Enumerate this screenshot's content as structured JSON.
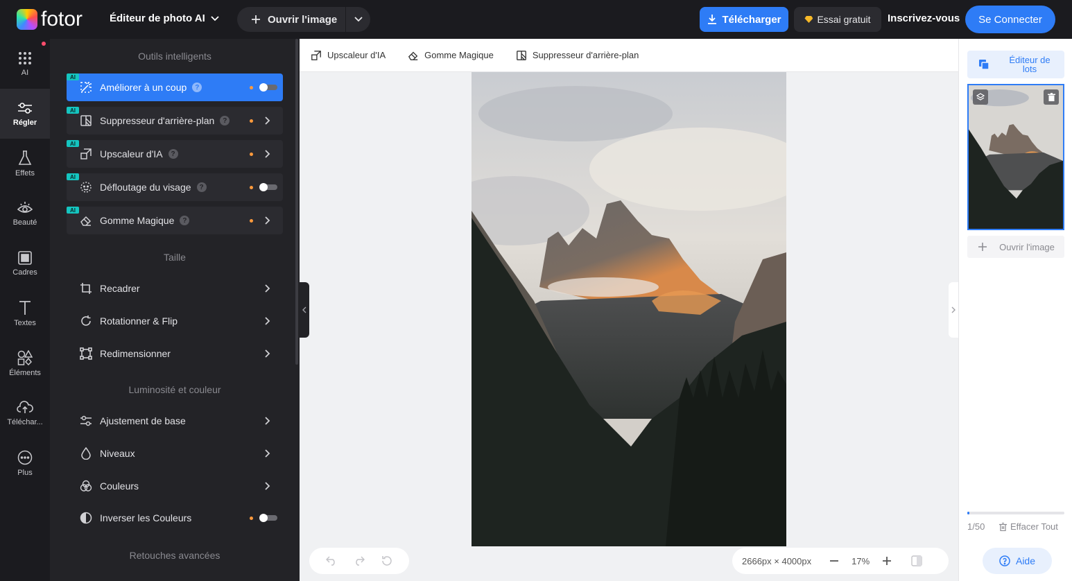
{
  "topbar": {
    "logo_text": "fotor",
    "app_title": "Éditeur de photo AI",
    "open_image": "Ouvrir l'image",
    "download": "Télécharger",
    "trial": "Essai gratuit",
    "signup": "Inscrivez-vous",
    "login": "Se Connecter"
  },
  "rail": [
    {
      "label": "AI",
      "icon": "grid-dots-icon"
    },
    {
      "label": "Régler",
      "icon": "sliders-icon"
    },
    {
      "label": "Effets",
      "icon": "flask-icon"
    },
    {
      "label": "Beauté",
      "icon": "eye-icon"
    },
    {
      "label": "Cadres",
      "icon": "frame-icon"
    },
    {
      "label": "Textes",
      "icon": "text-icon"
    },
    {
      "label": "Éléments",
      "icon": "shapes-icon"
    },
    {
      "label": "Téléchar...",
      "icon": "cloud-upload-icon"
    },
    {
      "label": "Plus",
      "icon": "more-icon"
    }
  ],
  "panel": {
    "section_smart": "Outils intelligents",
    "smart_tools": [
      {
        "label": "Améliorer à un coup",
        "control": "toggle",
        "active": true,
        "icon": "magic-enhance-icon"
      },
      {
        "label": "Suppresseur d'arrière-plan",
        "control": "chevron",
        "active": false,
        "icon": "background-remove-icon"
      },
      {
        "label": "Upscaleur d'IA",
        "control": "chevron",
        "active": false,
        "icon": "upscale-icon"
      },
      {
        "label": "Défloutage du visage",
        "control": "toggle",
        "active": false,
        "icon": "face-unblur-icon"
      },
      {
        "label": "Gomme Magique",
        "control": "chevron",
        "active": false,
        "icon": "eraser-icon"
      }
    ],
    "ai_badge": "AI",
    "help_glyph": "?",
    "section_size": "Taille",
    "size_tools": [
      {
        "label": "Recadrer",
        "icon": "crop-icon"
      },
      {
        "label": "Rotationner & Flip",
        "icon": "rotate-icon"
      },
      {
        "label": "Redimensionner",
        "icon": "resize-icon"
      }
    ],
    "section_light": "Luminosité et couleur",
    "light_tools": [
      {
        "label": "Ajustement de base",
        "icon": "sliders-small-icon"
      },
      {
        "label": "Niveaux",
        "icon": "drop-icon"
      },
      {
        "label": "Couleurs",
        "icon": "color-circles-icon"
      }
    ],
    "invert": {
      "label": "Inverser les Couleurs",
      "icon": "invert-icon"
    },
    "section_advanced": "Retouches avancées"
  },
  "toolbar": [
    {
      "label": "Upscaleur d'IA",
      "icon": "upscale-icon"
    },
    {
      "label": "Gomme Magique",
      "icon": "eraser-icon"
    },
    {
      "label": "Suppresseur d'arrière-plan",
      "icon": "background-remove-icon"
    }
  ],
  "canvas": {
    "dimensions": "2666px × 4000px",
    "zoom": "17%"
  },
  "rightpanel": {
    "batch_editor": "Éditeur de lots",
    "open_image": "Ouvrir l'image",
    "count": "1/50",
    "progress": 0.02,
    "clear_all": "Effacer Tout",
    "help": "Aide"
  },
  "colors": {
    "accent": "#2e7cf6",
    "dark_bg": "#1b1b1f",
    "panel_bg": "#232327",
    "ai_badge": "#15c5c0",
    "pro_dot": "#ff9a3c"
  }
}
